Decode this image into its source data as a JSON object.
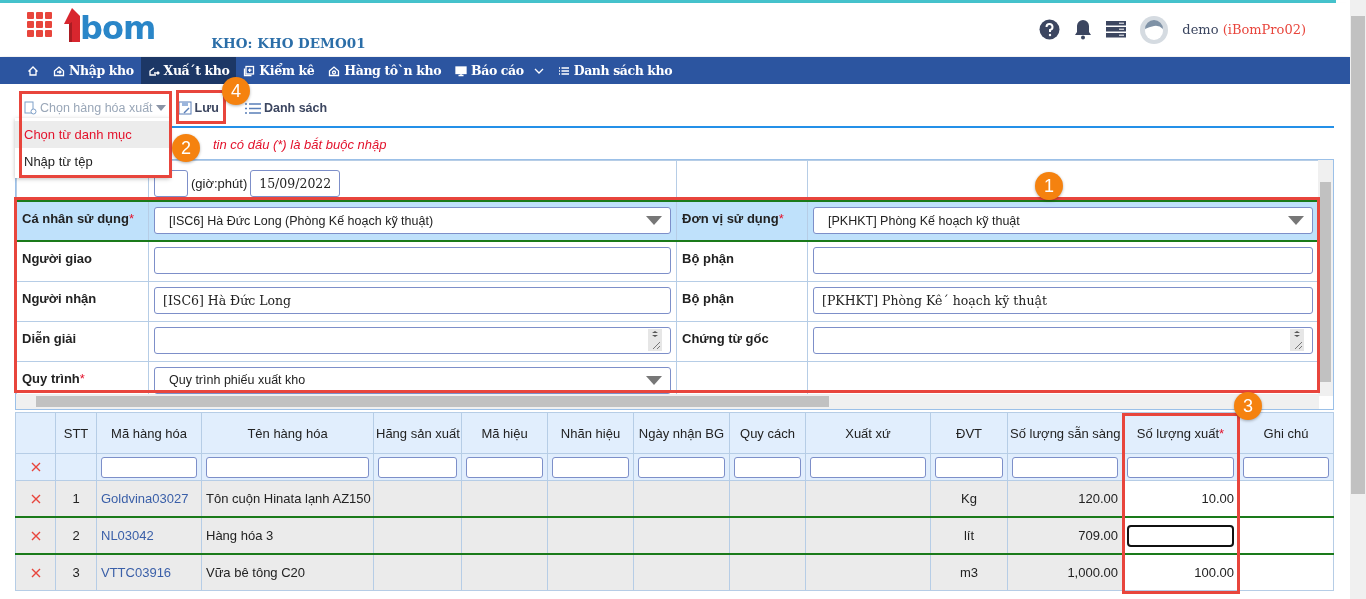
{
  "header": {
    "logo": "bom",
    "warehouse": "KHO: KHO DEMO01",
    "user": "demo",
    "account": "(iBomPro02)"
  },
  "nav": [
    {
      "kind": "home",
      "selected": false
    },
    {
      "kind": "import",
      "label": "Nhập kho",
      "selected": false
    },
    {
      "kind": "export",
      "label": "Xuấ´t kho",
      "selected": true
    },
    {
      "kind": "check",
      "label": "Kiểm kê",
      "selected": false
    },
    {
      "kind": "stock",
      "label": "Hàng tô`n kho",
      "selected": false
    },
    {
      "kind": "report",
      "label": "Báo cáo",
      "selected": false
    },
    {
      "kind": "list",
      "label": "Danh sách kho",
      "selected": false
    }
  ],
  "toolbar": {
    "picker": {
      "label": "Chọn hàng hóa xuất",
      "disabled": true
    },
    "save": "Lưu",
    "list": "Danh sách"
  },
  "menu": [
    {
      "label": "Chọn từ danh mục",
      "selected": true
    },
    {
      "label": "Nhập từ tệp",
      "selected": false
    }
  ],
  "notice": "tin có dấu (*) là bắt buộc nhập",
  "time_row": {
    "time_label": "(giờ:phút)",
    "date": "15/09/2022"
  },
  "form_rows": [
    {
      "highlighted": true,
      "cells": [
        {
          "label": "Cá nhân sử dụng",
          "required_mark": "*",
          "kind": "select",
          "value": "[ISC6] Hà Đức Long (Phòng Kế hoạch kỹ thuật)"
        },
        {
          "label": "Đơn vị sử dụng",
          "required_mark": "*",
          "kind": "select",
          "value": "[PKHKT] Phòng Kế hoạch kỹ thuật"
        }
      ]
    },
    {
      "highlighted": false,
      "cells": [
        {
          "label": "Người giao",
          "kind": "input"
        },
        {
          "label": "Bộ phận",
          "kind": "input"
        }
      ]
    },
    {
      "highlighted": false,
      "cells": [
        {
          "label": "Người nhận",
          "kind": "input",
          "value": "[ISC6] Hà Đức Long"
        },
        {
          "label": "Bộ phận",
          "kind": "input",
          "value": "[PKHKT] Phòng Kê´ hoạch kỹ thuật"
        }
      ]
    },
    {
      "highlighted": false,
      "cells": [
        {
          "label": "Diễn giải",
          "kind": "textarea"
        },
        {
          "label": "Chứng từ gốc",
          "kind": "textarea"
        }
      ]
    },
    {
      "highlighted": false,
      "cells": [
        {
          "label": "Quy trình",
          "required_mark": "*",
          "kind": "select",
          "value": "Quy trình phiếu xuất kho"
        }
      ]
    }
  ],
  "grid": {
    "columns": [
      {
        "label": "STT",
        "filter": false
      },
      {
        "label": "Mã hàng hóa",
        "filter": true
      },
      {
        "label": "Tên hàng hóa",
        "filter": true
      },
      {
        "label": "Hãng sản xuất",
        "filter": true
      },
      {
        "label": "Mã hiệu",
        "filter": true
      },
      {
        "label": "Nhãn hiệu",
        "filter": true
      },
      {
        "label": "Ngày nhận BG",
        "filter": true
      },
      {
        "label": "Quy cách",
        "filter": true
      },
      {
        "label": "Xuất xứ",
        "filter": true
      },
      {
        "label": "ĐVT",
        "filter": true
      },
      {
        "label": "Số lượng sẵn sàng",
        "filter": true
      },
      {
        "label": "Số lượng xuất",
        "required_mark": "*",
        "filter": true
      },
      {
        "label": "Ghi chú",
        "filter": true
      }
    ],
    "rows": [
      {
        "stt": "1",
        "code": "Goldvina03027",
        "name": "Tôn cuộn Hinata lạnh AZ150",
        "unit": "Kg",
        "available": "120.00",
        "quantity": "10.00",
        "editing": false
      },
      {
        "stt": "2",
        "code": "NL03042",
        "name": "Hàng hóa 3",
        "unit": "lít",
        "available": "709.00",
        "editing": true
      },
      {
        "stt": "3",
        "code": "VTTC03916",
        "name": "Vữa bê tông C20",
        "unit": "m3",
        "available": "1,000.00",
        "quantity": "100.00",
        "editing": false
      }
    ]
  },
  "callouts": [
    {
      "number": "1"
    },
    {
      "number": "2"
    },
    {
      "number": "3"
    },
    {
      "number": "4"
    }
  ]
}
